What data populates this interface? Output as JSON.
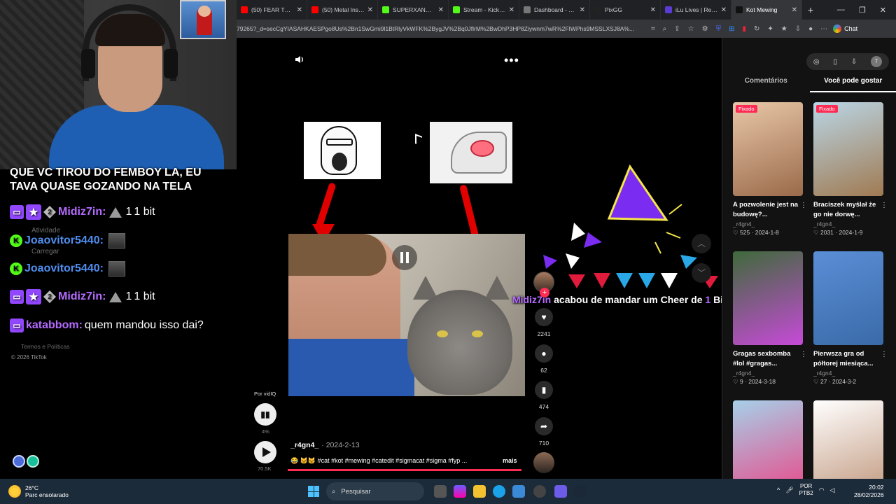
{
  "browser": {
    "tabs": [
      {
        "title": "(50) FEAR THE C",
        "color": "#ff0000",
        "active": false
      },
      {
        "title": "(50) Metal Instru",
        "color": "#ff0000",
        "active": false
      },
      {
        "title": "SUPERXANDAO",
        "color": "#53fc18",
        "active": false
      },
      {
        "title": "Stream - Kick Da",
        "color": "#53fc18",
        "active": false
      },
      {
        "title": "Dashboard - Live",
        "color": "#777777",
        "active": false
      },
      {
        "title": "PixGG",
        "color": "#222222",
        "active": false
      },
      {
        "title": "iLu Lives | React",
        "color": "#5b3bd6",
        "active": false
      },
      {
        "title": "Kot Mewing",
        "color": "#111111",
        "active": true
      }
    ],
    "url": "79265?_d=secCgYIASAHKAESPgo8Us%2Bn1SwGmi9l1BtRlyVkWFK%2BygJV%2Bq0JflrM%2BwDhP3HP8Ziywnm7wR%2FIWPhs9MSSLXSJ8A%...",
    "chat_label": "Chat"
  },
  "stream": {
    "alert_message": "QUE VC TIROU DO FEMBOY LA, EU TAVA QUASE GOZANDO NA TELA",
    "chat": [
      {
        "platform": "twitch",
        "badges": [
          "star",
          "2"
        ],
        "user": "Midiz7in:",
        "user_color": "purple",
        "text": "1 bit",
        "prefix": "1",
        "has_tri": true,
        "emote": false
      },
      {
        "platform": "kick",
        "badges": [],
        "user": "Joaovitor5440:",
        "user_color": "blue",
        "text": "",
        "prefix": "",
        "has_tri": false,
        "emote": true
      },
      {
        "platform": "kick",
        "badges": [],
        "user": "Joaovitor5440:",
        "user_color": "blue",
        "text": "",
        "prefix": "",
        "has_tri": false,
        "emote": true
      },
      {
        "platform": "twitch",
        "badges": [
          "star",
          "2"
        ],
        "user": "Midiz7in:",
        "user_color": "purple",
        "text": "1 bit",
        "prefix": "1",
        "has_tri": true,
        "emote": false
      },
      {
        "platform": "twitch",
        "badges": [],
        "user": "katabbom:",
        "user_color": "purple",
        "text": "quem mandou isso dai?",
        "prefix": "",
        "has_tri": false,
        "emote": false
      }
    ],
    "cheer": {
      "user": "Midiz7in",
      "middle": " acabou de mandar um Cheer de ",
      "amount": "1",
      "suffix": " Bits!"
    }
  },
  "tiktok_left": {
    "ghost_items": [
      "Atividade",
      "Carregar",
      "Termos e Políticas"
    ],
    "footer": "© 2026 TikTok"
  },
  "video": {
    "vidiq_label": "Por vidIQ",
    "vidiq_pct": "4%",
    "views": "70.5K",
    "author": "_r4gn4_",
    "date": "· 2024-2-13",
    "caption": "😂 🐱🐱 #cat #kot #mewing #catedit #sigmacat #sigma #fyp ...",
    "more": "mais",
    "likes": "2241",
    "comments": "62",
    "saves": "474",
    "shares": "710",
    "progress": 1.0
  },
  "right_panel": {
    "tabs": [
      "Comentários",
      "Você pode gostar"
    ],
    "active_tab": 1,
    "avatar_letter": "T",
    "cards": [
      {
        "pinned": "Fixado",
        "title": "A pozwolenie jest na budowę?...",
        "author": "_r4gn4_",
        "likes": "525",
        "date": "2024-1-8",
        "color1": "#e8c7a8",
        "color2": "#9a6a4a"
      },
      {
        "pinned": "Fixado",
        "title": "Braciszek myślał że go nie dorwę...",
        "author": "_r4gn4_",
        "likes": "2031",
        "date": "2024-1-9",
        "color1": "#b9d6e6",
        "color2": "#a07a52"
      },
      {
        "pinned": "",
        "title": "Gragas sexbomba #lol #gragas...",
        "author": "_r4gn4_",
        "likes": "9",
        "date": "2024-3-18",
        "color1": "#3e6a3a",
        "color2": "#c74ad8"
      },
      {
        "pinned": "",
        "title": "Pierwsza gra od półtorej miesiąca...",
        "author": "_r4gn4_",
        "likes": "27",
        "date": "2024-3-2",
        "color1": "#5a8ed6",
        "color2": "#3a6aa8"
      },
      {
        "pinned": "",
        "title": "",
        "author": "",
        "likes": "",
        "date": "",
        "color1": "#a6d0e8",
        "color2": "#e84a8a"
      },
      {
        "pinned": "",
        "title": "",
        "author": "",
        "likes": "",
        "date": "",
        "color1": "#ffffff",
        "color2": "#c29a80"
      }
    ]
  },
  "taskbar": {
    "temperature": "26°C",
    "weather": "Parc ensolarado",
    "search": "Pesquisar",
    "lang1": "POR",
    "lang2": "PTB2",
    "time": "20:02",
    "date": "28/02/2026"
  },
  "colors": {
    "tiktok_red": "#fe2c55",
    "twitch_purple": "#9146ff",
    "kick_green": "#53fc18"
  }
}
